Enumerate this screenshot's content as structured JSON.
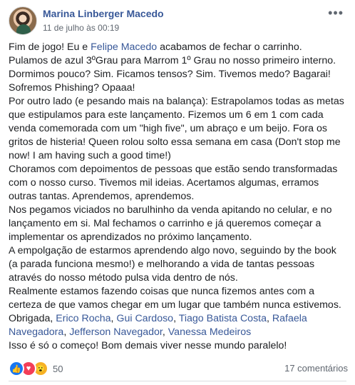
{
  "post": {
    "author": "Marina Linberger Macedo",
    "date": "11 de julho às 00:19",
    "paragraphs": [
      [
        {
          "text": "Fim de jogo! Eu e "
        },
        {
          "text": "Felipe Macedo",
          "mention": true
        },
        {
          "text": " acabamos de fechar o carrinho."
        }
      ],
      [
        {
          "text": "Pulamos de azul 3ºGrau para Marrom 1º Grau no nosso primeiro interno."
        }
      ],
      [
        {
          "text": "Dormimos pouco? Sim. Ficamos tensos? Sim. Tivemos medo? Bagarai!"
        }
      ],
      [
        {
          "text": "Sofremos Phishing? Opaaa!"
        }
      ],
      [
        {
          "text": "Por outro lado (e pesando mais na balança): Estrapolamos todas as metas que estipulamos para este lançamento. Fizemos um 6 em 1 com cada venda comemorada com um \"high five\", um abraço e um beijo. Fora os gritos de histeria! Queen rolou solto essa semana em casa (Don't stop me now! I am having such a good time!)"
        }
      ],
      [
        {
          "text": "Choramos com depoimentos de pessoas que estão sendo transformadas com o nosso curso. Tivemos mil ideias. Acertamos algumas, erramos outras tantas. Aprendemos, aprendemos."
        }
      ],
      [
        {
          "text": "Nos pegamos viciados no barulhinho da venda apitando no celular, e no lançamento em si. Mal fechamos o carrinho e já queremos começar a implementar os aprendizados no próximo lançamento."
        }
      ],
      [
        {
          "text": "A empolgação de estarmos aprendendo algo novo, seguindo by the book (a parada funciona mesmo!) e melhorando a vida de tantas pessoas através do nosso método pulsa vida dentro de nós."
        }
      ],
      [
        {
          "text": "Realmente estamos fazendo coisas que nunca fizemos antes com a certeza de que vamos chegar em um lugar que também nunca estivemos."
        }
      ],
      [
        {
          "text": "Obrigada, "
        },
        {
          "text": "Erico Rocha",
          "mention": true
        },
        {
          "text": ", "
        },
        {
          "text": "Gui Cardoso",
          "mention": true
        },
        {
          "text": ", "
        },
        {
          "text": "Tiago Batista Costa",
          "mention": true
        },
        {
          "text": ", "
        },
        {
          "text": "Rafaela Navegadora",
          "mention": true
        },
        {
          "text": ", "
        },
        {
          "text": "Jefferson Navegador",
          "mention": true
        },
        {
          "text": ", "
        },
        {
          "text": "Vanessa Medeiros",
          "mention": true
        }
      ],
      [
        {
          "text": "Isso é só o começo! Bom demais viver nesse mundo paralelo!"
        }
      ]
    ]
  },
  "footer": {
    "reaction_icons": [
      {
        "name": "like-reaction-icon",
        "glyph": "👍",
        "color": "#1877f2"
      },
      {
        "name": "love-reaction-icon",
        "glyph": "♥",
        "color": "#f33e58"
      },
      {
        "name": "wow-reaction-icon",
        "glyph": "😮",
        "color": "#f7b125"
      }
    ],
    "reaction_count": "50",
    "comments": "17 comentários"
  },
  "colors": {
    "link": "#385898",
    "text": "#1c1e21",
    "muted": "#606770"
  }
}
